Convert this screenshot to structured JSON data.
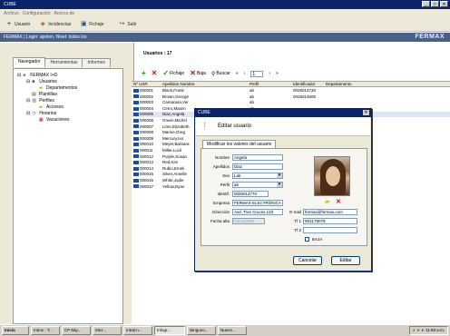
{
  "window": {
    "title": "CUBE",
    "controls": [
      "_",
      "□",
      "✕"
    ]
  },
  "menu": [
    "Archivo",
    "Configuración",
    "Acerca de"
  ],
  "toolbar": [
    {
      "label": "Usuario",
      "icon": "add-user-icon"
    },
    {
      "label": "Incidencias",
      "icon": "incidents-icon"
    },
    {
      "label": "Fichaje",
      "icon": "clock-icon"
    },
    {
      "label": "Salir",
      "icon": "exit-icon"
    }
  ],
  "app": {
    "header": "FERMAX | Login: apolon, Nivel: todos los",
    "brand": "FERMAX"
  },
  "sidebar": {
    "tabs": [
      "Navegador",
      "Herramientas",
      "Informes"
    ],
    "tree": [
      {
        "label": "FERMAX I+D",
        "icon": "company-icon",
        "level": 0
      },
      {
        "label": "Usuarios",
        "icon": "users-icon",
        "level": 1
      },
      {
        "label": "Departamentos",
        "icon": "folder-icon",
        "level": 2
      },
      {
        "label": "Plantillas",
        "icon": "template-icon",
        "level": 1
      },
      {
        "label": "Perfiles",
        "icon": "profile-icon",
        "level": 1
      },
      {
        "label": "Accesos",
        "icon": "folder-icon",
        "level": 2
      },
      {
        "label": "Horarios",
        "icon": "clock-icon",
        "level": 1
      },
      {
        "label": "Vacaciones",
        "icon": "calendar-icon",
        "level": 2
      }
    ]
  },
  "grid": {
    "title": "Usuarios : 17",
    "toolbar": {
      "save": "Fichaje",
      "delete": "Baja",
      "search": "Buscar",
      "page": "1"
    },
    "columns": [
      "Nº USR",
      "Apellidos Nombre",
      "Perfil",
      "Identificador",
      "Departamento"
    ],
    "rows": [
      [
        "000001",
        "Black,Frank",
        "ab",
        "0025014730",
        ""
      ],
      [
        "000002",
        "Brown,George",
        "ab",
        "0025014600",
        ""
      ],
      [
        "000003",
        "Camarasa,Ver",
        "ab",
        "",
        ""
      ],
      [
        "000004",
        "Cerro,Maxim",
        "ab",
        "",
        ""
      ],
      [
        "000005",
        "Diaz,Angela",
        "ab",
        "",
        ""
      ],
      [
        "000006",
        "Green,Michel",
        "ab",
        "",
        ""
      ],
      [
        "000007",
        "Lime,Elizabeth",
        "ab",
        "",
        ""
      ],
      [
        "000008",
        "Marine,Greg",
        "ab",
        "",
        ""
      ],
      [
        "000009",
        "Mercury,Ivo",
        "ab",
        "",
        ""
      ],
      [
        "000010",
        "Meyer,Barbara",
        "ab",
        "",
        ""
      ],
      [
        "000011",
        "Miller,Lucil",
        "ab",
        "",
        ""
      ],
      [
        "000012",
        "Purple,Susan",
        "ab",
        "",
        ""
      ],
      [
        "000013",
        "Red,Kim",
        "ab",
        "",
        ""
      ],
      [
        "000014",
        "Rubio,Emeli",
        "ab",
        "",
        ""
      ],
      [
        "000015",
        "Silver,Anselle",
        "ab",
        "",
        ""
      ],
      [
        "000016",
        "White,Jodie",
        "ab",
        "",
        ""
      ],
      [
        "000017",
        "Yellow,Dyan",
        "ab",
        "",
        ""
      ]
    ]
  },
  "dialog": {
    "title": "CUBE",
    "header": "Editar usuario",
    "tab": "Modificar los valores del usuario",
    "fields": {
      "nombre_label": "Nombre",
      "nombre": "Angela",
      "apellidos_label": "Apellidos",
      "apellidos": "Diaz",
      "sex_label": "Sex",
      "sex": "Lab",
      "perfil_label": "Perfil",
      "perfil": "ab",
      "ident_label": "Identif.",
      "ident": "0025014770",
      "empresa_label": "Empresa",
      "empresa": "FERMAX ELECTRÓNICA",
      "direccion_label": "Dirección",
      "direccion": "Avd. Tres Cruces 133",
      "fecha_label": "Fecha alta",
      "fecha": "04/10/2006",
      "email_label": "E-mail",
      "email": "fermax@fermax.com",
      "tel1_label": "Tf 1",
      "tel1": "963178079",
      "tel2_label": "Tf 2",
      "tel2": "",
      "baja_label": "BAJA"
    },
    "buttons": {
      "cancel": "Cancelar",
      "edit": "Editar"
    }
  },
  "taskbar": {
    "start": "Inicio",
    "tasks": [
      "Inbox - T...",
      "CP Mig...",
      "Micr...",
      "Intral.n...",
      "Infogr...",
      "Ninguno...",
      "Nuevo..."
    ],
    "clock": "11:58 a.m."
  }
}
